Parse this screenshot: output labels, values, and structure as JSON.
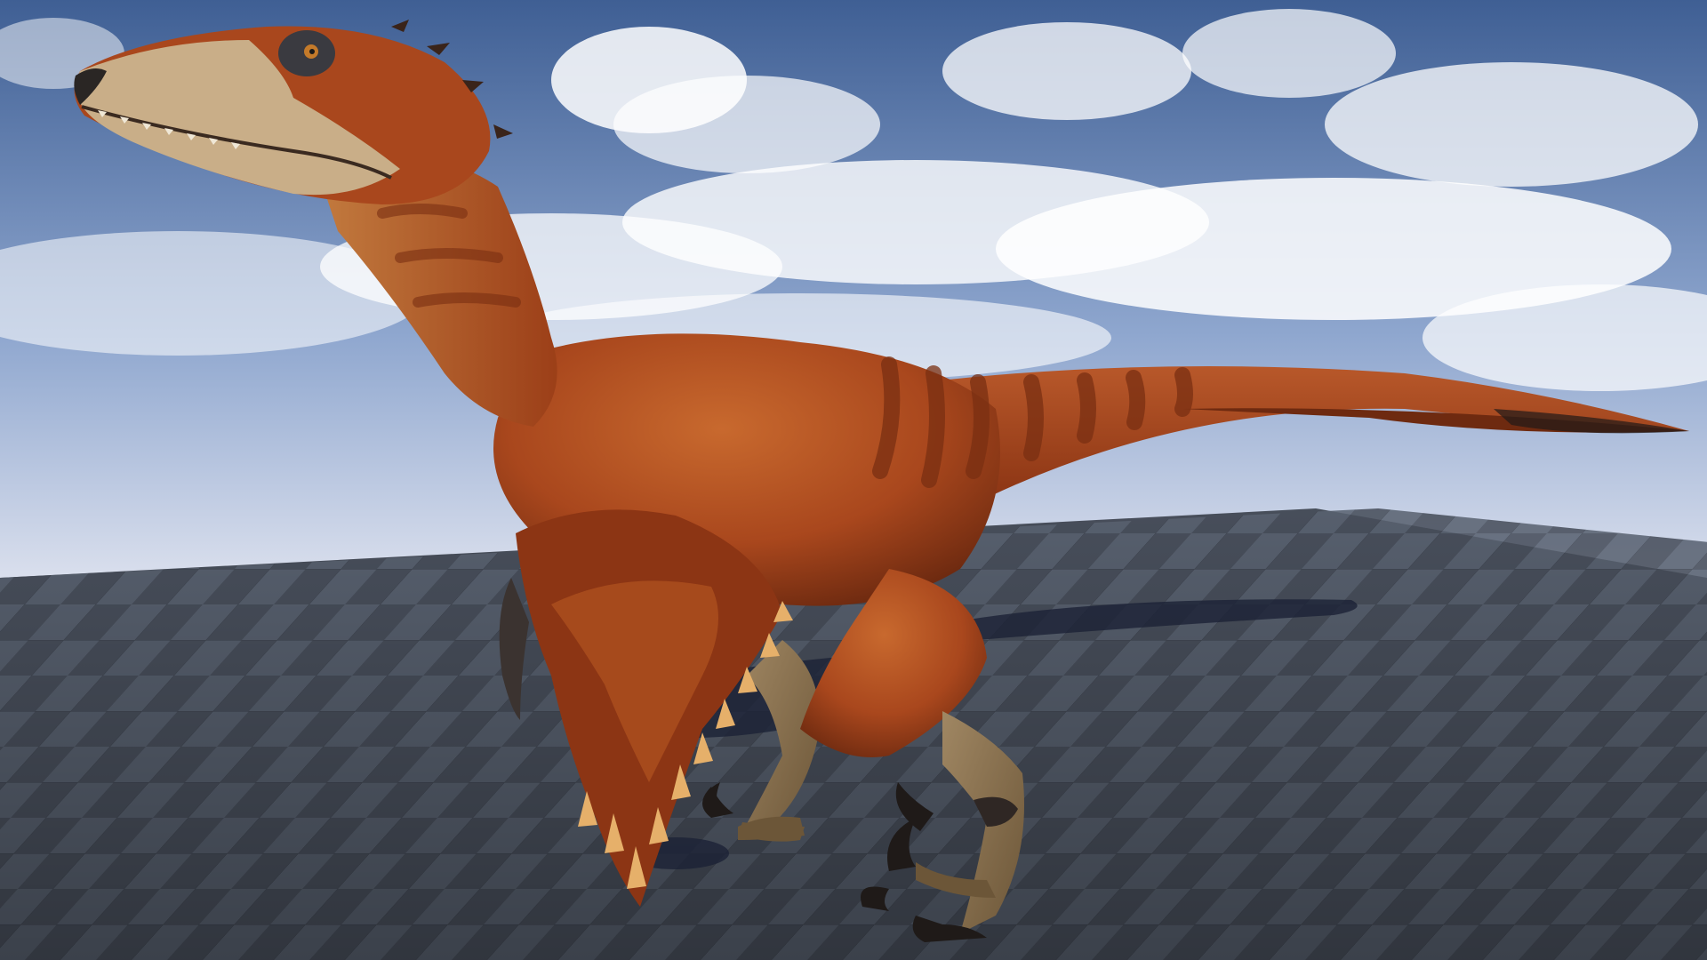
{
  "scene": {
    "subject": "feathered-raptor-model",
    "environment": "checkered-floor-under-cloudy-sky"
  },
  "colors": {
    "sky_top": "#3f5f94",
    "sky_mid": "#8fa7cf",
    "sky_horizon": "#dfe3ef",
    "cloud": "#ffffff",
    "floor_dark": "#3a404b",
    "floor_light": "#5f6877",
    "shadow": "#1c2236",
    "feather_rust": "#a9471d",
    "feather_dark": "#6e2a10",
    "feather_light": "#d58a48",
    "stripe": "#7a2f12",
    "snout_tan": "#c9ae88",
    "leg_skin": "#8a7152",
    "claw": "#1f1a18",
    "wing_tip": "#e6b06a"
  }
}
